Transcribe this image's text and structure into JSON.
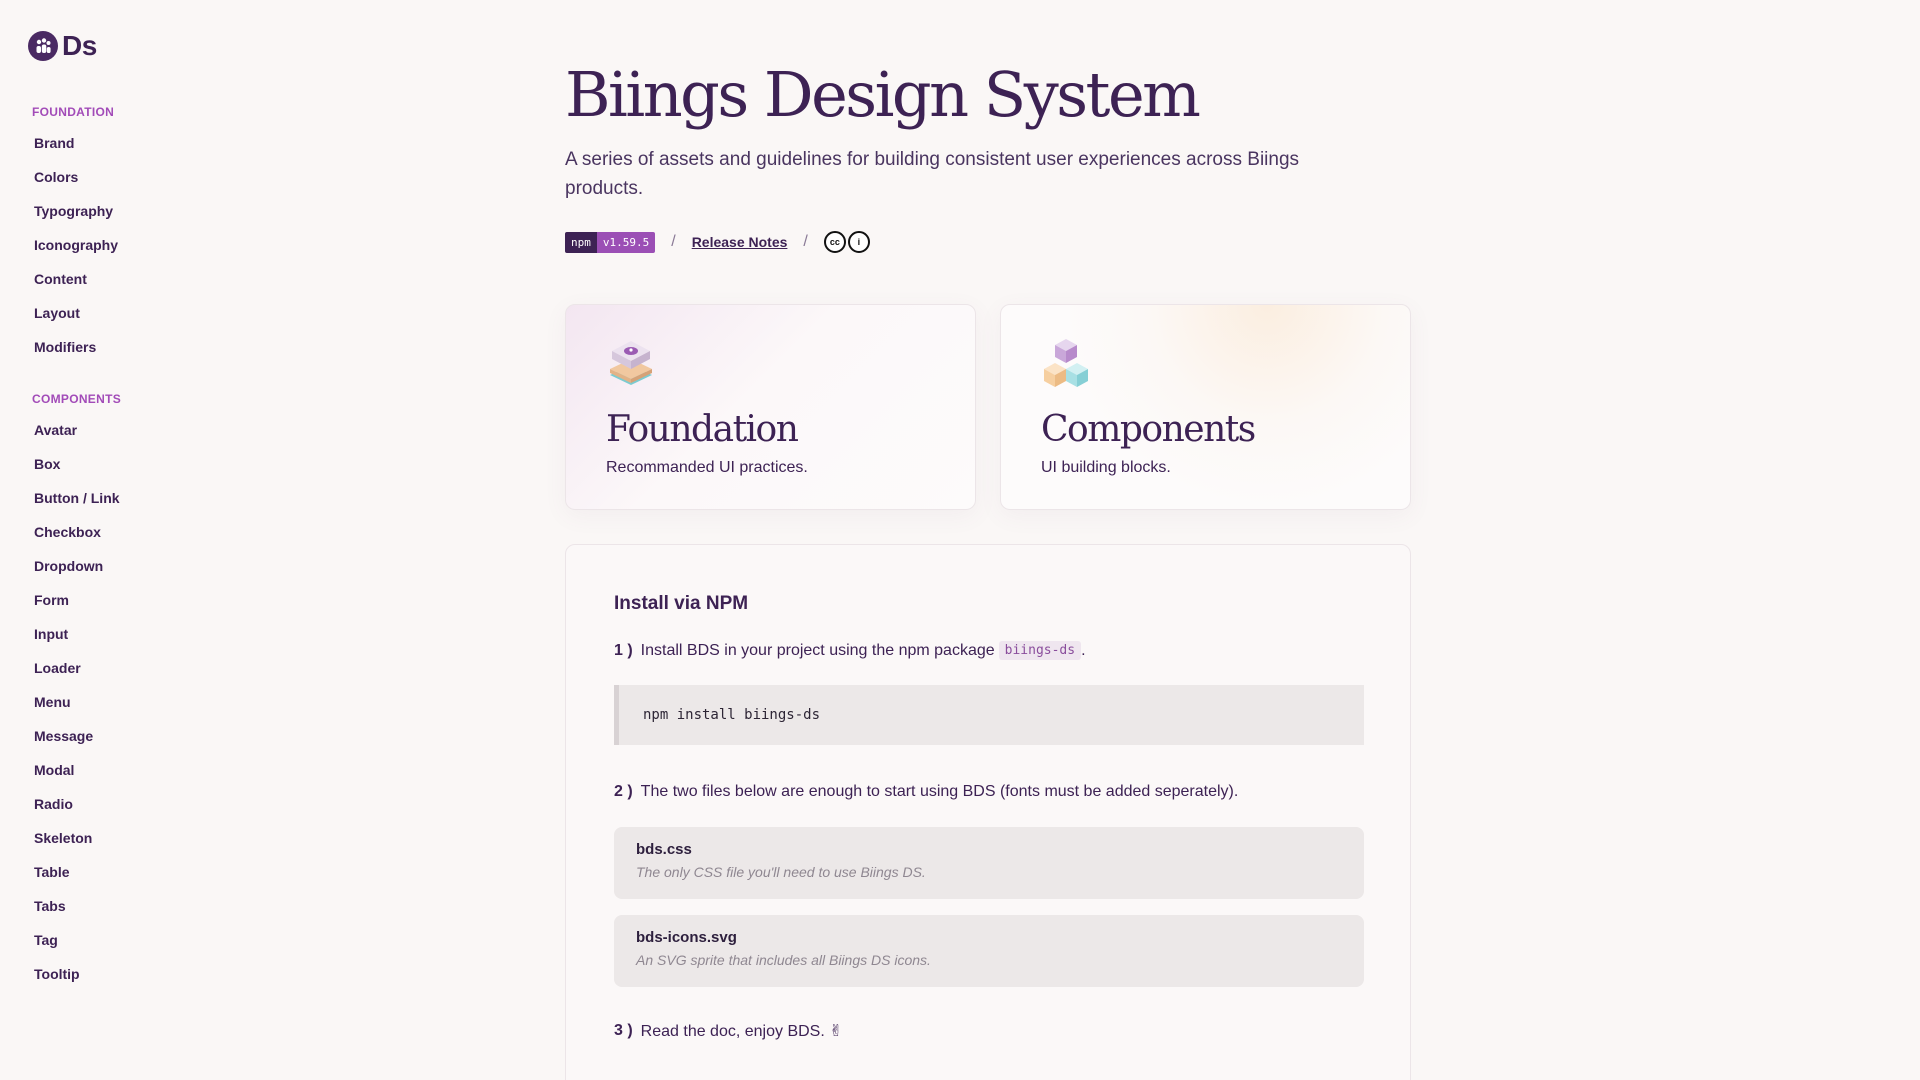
{
  "logo": {
    "text": "Ds"
  },
  "sidebar": {
    "foundation": {
      "title": "FOUNDATION",
      "items": [
        "Brand",
        "Colors",
        "Typography",
        "Iconography",
        "Content",
        "Layout",
        "Modifiers"
      ]
    },
    "components": {
      "title": "COMPONENTS",
      "items": [
        "Avatar",
        "Box",
        "Button / Link",
        "Checkbox",
        "Dropdown",
        "Form",
        "Input",
        "Loader",
        "Menu",
        "Message",
        "Modal",
        "Radio",
        "Skeleton",
        "Table",
        "Tabs",
        "Tag",
        "Tooltip"
      ]
    }
  },
  "hero": {
    "title": "Biings Design System",
    "subtitle": "A series of assets and guidelines for building consistent user experiences across Biings products.",
    "npm_label": "npm",
    "npm_version": "v1.59.5",
    "separator": "/",
    "release_notes": "Release Notes",
    "cc_symbol": "cc",
    "by_symbol": "i"
  },
  "cards": {
    "foundation": {
      "title": "Foundation",
      "desc": "Recommanded UI practices."
    },
    "components": {
      "title": "Components",
      "desc": "UI building blocks."
    }
  },
  "install": {
    "title": "Install via NPM",
    "step1": {
      "num": "1 )",
      "text": "Install BDS in your project using the npm package",
      "code": "biings-ds",
      "suffix": "."
    },
    "command": "npm install biings-ds",
    "step2": {
      "num": "2 )",
      "text": "The two files below are enough to start using BDS (fonts must be added seperately)."
    },
    "files": [
      {
        "name": "bds.css",
        "desc": "The only CSS file you'll need to use Biings DS."
      },
      {
        "name": "bds-icons.svg",
        "desc": "An SVG sprite that includes all Biings DS icons."
      }
    ],
    "step3": {
      "num": "3 )",
      "text": "Read the doc, enjoy BDS. ✌"
    }
  },
  "colors": {
    "brand": "#3d2254",
    "accent": "#a24bb8",
    "background": "#faf7f6"
  }
}
